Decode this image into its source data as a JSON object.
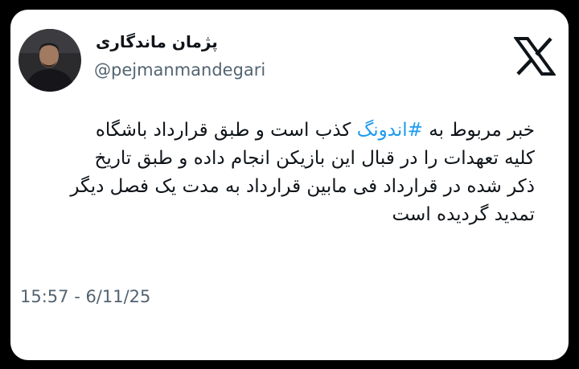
{
  "author": {
    "display_name": "پژمان ماندگاری",
    "handle": "@pejmanmandegari",
    "avatar_icon": "profile-photo"
  },
  "platform": {
    "logo_icon": "x-logo-icon"
  },
  "tweet": {
    "line1_before": "خبر مربوط به ",
    "hashtag": "#اندونگ",
    "line1_after": " کذب است و طبق قرارداد باشگاه",
    "line2": "کلیه تعهدات را در قبال این بازیکن انجام داده و طبق تاریخ",
    "line3": "ذکر شده در قرارداد فی مابین قرارداد به مدت یک فصل دیگر",
    "line4": "تمدید گردیده است"
  },
  "timestamp": "15:57 - 6/11/25",
  "colors": {
    "hashtag": "#1d9bf0",
    "text": "#0f1419",
    "secondary": "#536471",
    "card": "#ffffff",
    "background": "#000000"
  }
}
